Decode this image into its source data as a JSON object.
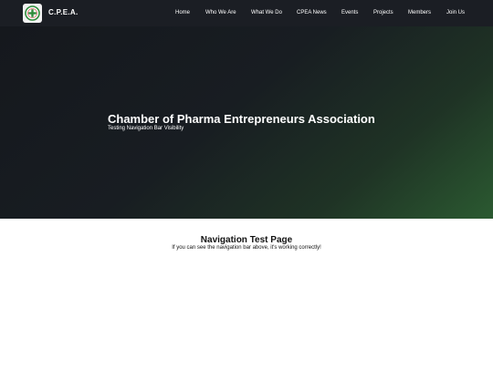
{
  "nav": {
    "brand": "C.P.E.A.",
    "links": [
      "Home",
      "Who We Are",
      "What We Do",
      "CPEA News",
      "Events",
      "Projects",
      "Members",
      "Join Us"
    ]
  },
  "hero": {
    "title": "Chamber of Pharma Entrepreneurs Association",
    "subtitle": "Testing Navigation Bar Visibility"
  },
  "content": {
    "title": "Navigation Test Page",
    "text": "If you can see the navigation bar above, it's working correctly!"
  },
  "colors": {
    "navbar": "#1b1e24",
    "hero_dark": "#15181d",
    "hero_green": "#2b5a31",
    "logo_green": "#2e8b3a",
    "logo_red": "#c0392b"
  },
  "icons": {
    "logo": "cpea-logo-icon"
  }
}
